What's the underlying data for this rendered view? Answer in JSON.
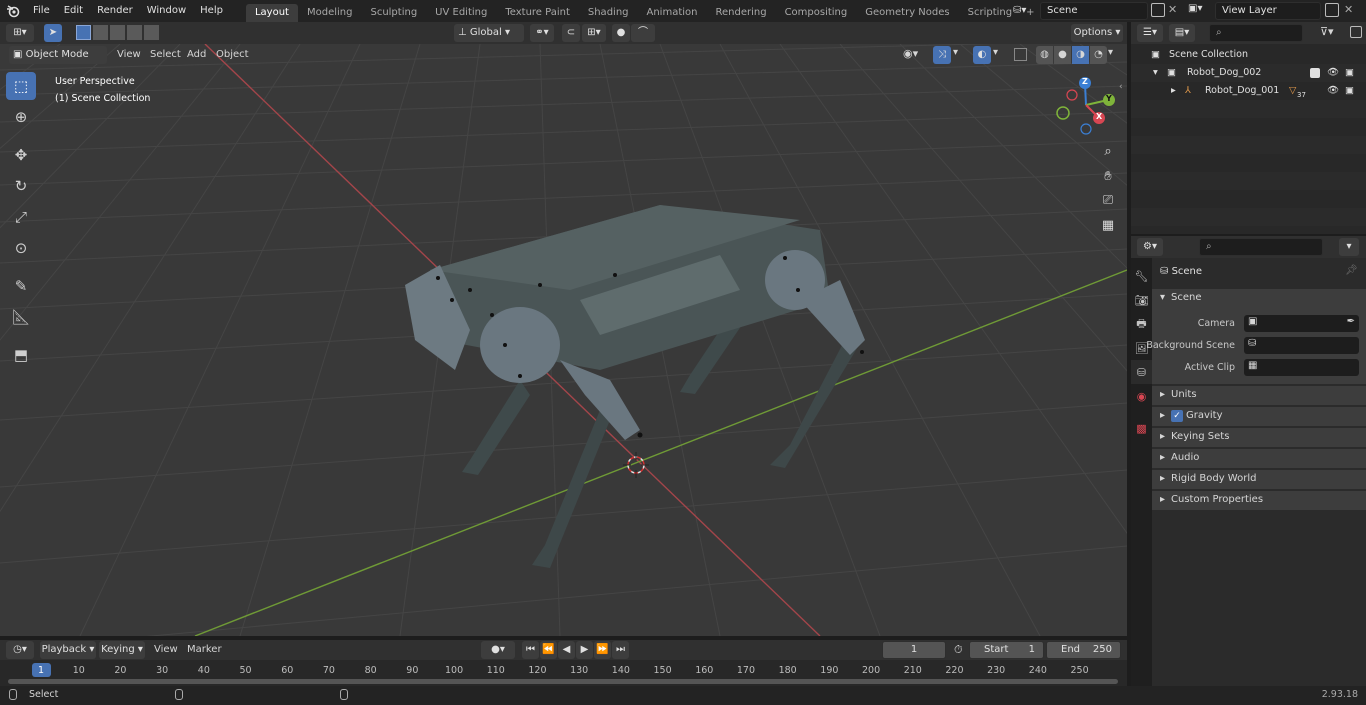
{
  "menu": [
    "File",
    "Edit",
    "Render",
    "Window",
    "Help"
  ],
  "workspaces": [
    {
      "label": "Layout",
      "active": true
    },
    {
      "label": "Modeling"
    },
    {
      "label": "Sculpting"
    },
    {
      "label": "UV Editing"
    },
    {
      "label": "Texture Paint"
    },
    {
      "label": "Shading"
    },
    {
      "label": "Animation"
    },
    {
      "label": "Rendering"
    },
    {
      "label": "Compositing"
    },
    {
      "label": "Geometry Nodes"
    },
    {
      "label": "Scripting"
    }
  ],
  "add_workspace": "+",
  "scene_name": "Scene",
  "view_layer": "View Layer",
  "viewport_header": {
    "mode": "Object Mode",
    "menus": [
      "View",
      "Select",
      "Add",
      "Object"
    ],
    "transform_orientation": "Global",
    "options": "Options"
  },
  "viewport_overlay": {
    "perspective": "User Perspective",
    "collection": "(1) Scene Collection"
  },
  "gizmo": {
    "x": "X",
    "y": "Y",
    "z": "Z"
  },
  "outliner": {
    "search_placeholder": "",
    "rows": [
      {
        "label": "Scene Collection"
      },
      {
        "label": "Robot_Dog_002"
      },
      {
        "label": "Robot_Dog_001",
        "badge": "37"
      }
    ]
  },
  "properties": {
    "context": "Scene",
    "panel": "Scene",
    "fields": [
      {
        "label": "Camera"
      },
      {
        "label": "Background Scene"
      },
      {
        "label": "Active Clip"
      }
    ],
    "subpanels": [
      "Units",
      "Gravity",
      "Keying Sets",
      "Audio",
      "Rigid Body World",
      "Custom Properties"
    ]
  },
  "timeline": {
    "menus": [
      "Playback",
      "Keying",
      "View",
      "Marker"
    ],
    "current_frame": "1",
    "start_label": "Start",
    "start": "1",
    "end_label": "End",
    "end": "250",
    "ruler": [
      "1",
      "10",
      "20",
      "30",
      "40",
      "50",
      "60",
      "70",
      "80",
      "90",
      "100",
      "110",
      "120",
      "130",
      "140",
      "150",
      "160",
      "170",
      "180",
      "190",
      "200",
      "210",
      "220",
      "230",
      "240",
      "250"
    ]
  },
  "status": {
    "left": "Select",
    "version": "2.93.18"
  },
  "colors": {
    "accent": "#4772b3",
    "x_axis": "#e05a5a",
    "y_axis": "#8ac04a"
  }
}
